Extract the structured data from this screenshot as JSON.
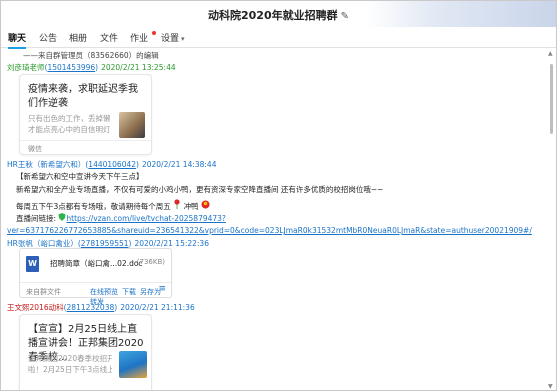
{
  "window": {
    "title": "动科院2020年就业招聘群",
    "title_edit_glyph": "✎"
  },
  "tabs": [
    {
      "label": "聊天",
      "active": true
    },
    {
      "label": "公告",
      "active": false
    },
    {
      "label": "相册",
      "active": false
    },
    {
      "label": "文件",
      "active": false
    },
    {
      "label": "作业",
      "active": false
    },
    {
      "label": "设置",
      "active": false,
      "caret": "▾"
    }
  ],
  "messages": {
    "m1": {
      "forward_line": "——来自群管理员（83562660）的编辑",
      "sender": "刘彦琦老师",
      "qq": "1501453996",
      "time": "2020/2/21 13:25:44",
      "card": {
        "title": "疫情来袭，求职延迟季我们作逆袭",
        "desc_1": "只有出色的工作，丢掉懒散，",
        "desc_2": "才能点亮心中的自信明灯...",
        "source": "微信"
      }
    },
    "m2": {
      "sender": "HR王秋（新希望六和）",
      "qq": "1440106042",
      "time": "2020/2/21 14:38:44",
      "line_1": "【新希望六和空中宣讲今天下午三点】",
      "line_2": "新希望六和全产业专场直播，不仅有可爱的小鸡小鸭，更有资深专家空降直播间  还有许多优质的校招岗位哦~~",
      "line_3_pre": "每周五下午3点都有专场哦，敬请期待每个周五",
      "line_3_post": "冲鸭",
      "line_4_label": "直播间链接:",
      "link_1": "https://vzan.com/live/tvchat-2025879473?",
      "link_2": "ver=637176226772653885&shareuid=236541322&vprid=0&code=023LJmaR0k31532mtMbR0NeuaR0LJmaR&state=authuser20021909#/"
    },
    "m3": {
      "sender": "HR张帆（峪口禽业）",
      "qq": "2781959551",
      "time": "2020/2/21 15:22:36",
      "file": {
        "icon_letter": "W",
        "name": "招聘简章（峪口禽...02.doc",
        "size": "(736KB)",
        "source": "来自群文件",
        "actions": [
          "在线预览",
          "下载",
          "另存为",
          "转发"
        ]
      }
    },
    "m4": {
      "sender": "王文熙2016动科",
      "qq": "2811232038",
      "time": "2020/2/21 21:11:36",
      "card": {
        "title": "【宣宣】2月25日线上直播宣讲会！正邦集团2020春季校...",
        "desc_1": "正邦集团2020春季校招开始",
        "desc_2": "啦！2月25日下午3点线上..."
      }
    }
  },
  "scrollbar": {
    "up_arrow": "▲",
    "down_arrow": "▼"
  },
  "colors": {
    "accent": "#1aa0e8",
    "link": "#1a73c8",
    "sender_green": "#2a9a2a",
    "sender_red": "#c41818"
  }
}
